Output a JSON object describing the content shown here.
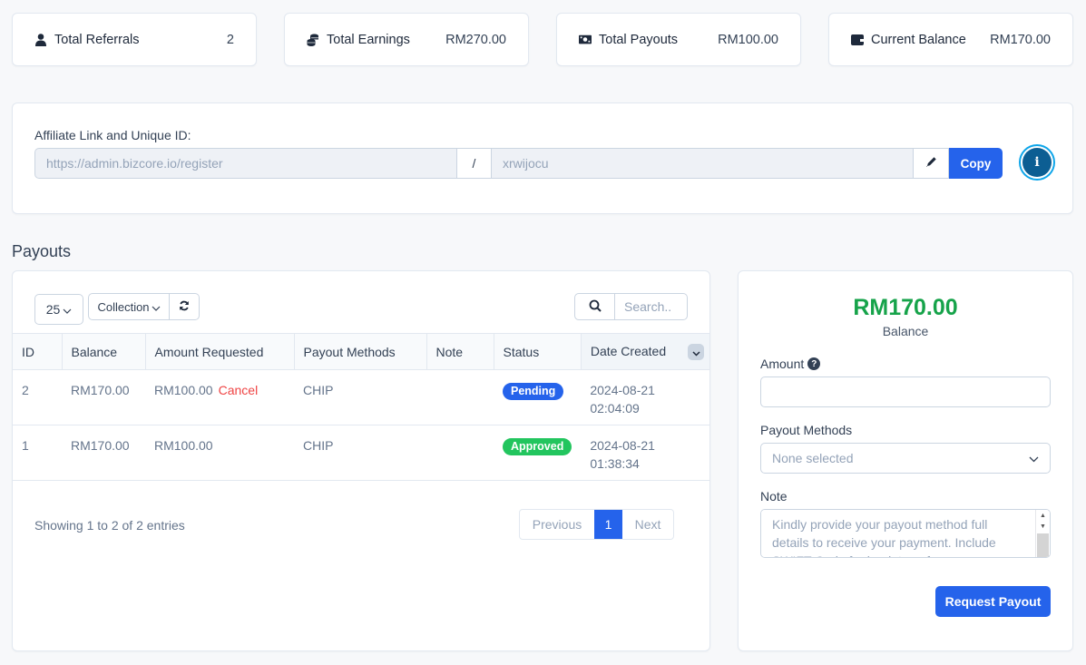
{
  "stats": [
    {
      "icon": "user-icon",
      "label": "Total Referrals",
      "value": "2"
    },
    {
      "icon": "coins-icon",
      "label": "Total Earnings",
      "value": "RM270.00"
    },
    {
      "icon": "money-bill-icon",
      "label": "Total Payouts",
      "value": "RM100.00"
    },
    {
      "icon": "wallet-icon",
      "label": "Current Balance",
      "value": "RM170.00"
    }
  ],
  "affiliate": {
    "title": "Affiliate Link and Unique ID:",
    "base_url": "https://admin.bizcore.io/register",
    "separator": "/",
    "unique_id": "xrwijocu",
    "copy_label": "Copy",
    "info_label": "i"
  },
  "payouts": {
    "section_title": "Payouts",
    "page_length": "25",
    "collection_label": "Collection",
    "search_placeholder": "Search..",
    "columns": [
      "ID",
      "Balance",
      "Amount Requested",
      "Payout Methods",
      "Note",
      "Status",
      "Date Created"
    ],
    "rows": [
      {
        "id": "2",
        "balance": "RM170.00",
        "amount": "RM100.00",
        "action": "Cancel",
        "method": "CHIP",
        "note": "",
        "status": "Pending",
        "date": "2024-08-21",
        "time": "02:04:09"
      },
      {
        "id": "1",
        "balance": "RM170.00",
        "amount": "RM100.00",
        "action": "",
        "method": "CHIP",
        "note": "",
        "status": "Approved",
        "date": "2024-08-21",
        "time": "01:38:34"
      }
    ],
    "info": "Showing 1 to 2 of 2 entries",
    "pagination": {
      "previous": "Previous",
      "current": "1",
      "next": "Next"
    }
  },
  "request": {
    "balance": "RM170.00",
    "balance_label": "Balance",
    "amount_label": "Amount",
    "amount_value": "",
    "methods_label": "Payout Methods",
    "methods_value": "None selected",
    "note_label": "Note",
    "note_placeholder": "Kindly provide your payout method full details to receive your payment. Include SWIFT Code for bank transfer",
    "submit_label": "Request Payout"
  },
  "colors": {
    "primary": "#2563eb",
    "success": "#22c55e",
    "balance_green": "#16a34a",
    "danger": "#ef4444",
    "info_dark": "#0c5e93"
  }
}
